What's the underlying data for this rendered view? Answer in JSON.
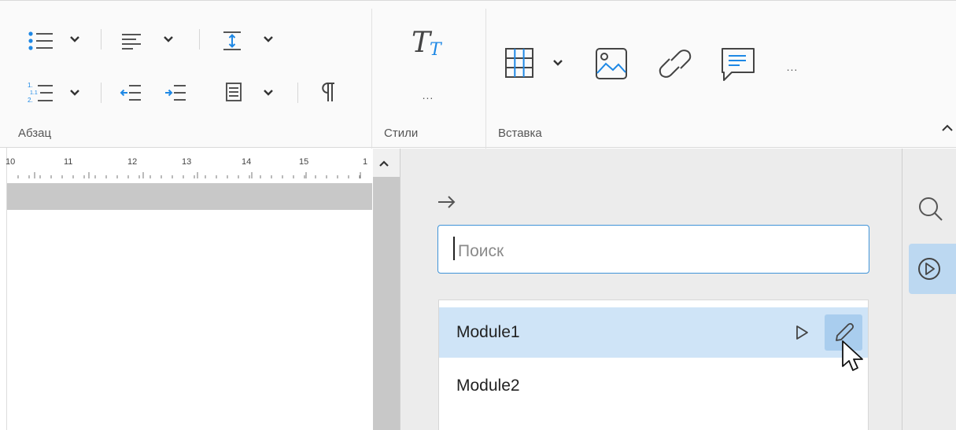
{
  "toolbar": {
    "groups": {
      "paragraph": "Абзац",
      "styles": "Стили",
      "insert": "Вставка"
    },
    "styles_more": "...",
    "insert_more": "..."
  },
  "ruler": {
    "labels": [
      "10",
      "11",
      "12",
      "13",
      "14",
      "15",
      "1"
    ]
  },
  "panel": {
    "search": {
      "placeholder": "Поиск",
      "value": ""
    },
    "modules": [
      {
        "label": "Module1",
        "selected": true
      },
      {
        "label": "Module2",
        "selected": false
      }
    ]
  },
  "colors": {
    "accent": "#3f93d8",
    "selected_row": "#cfe4f7",
    "selected_button": "#a9cdee",
    "panel_bg": "#ececec"
  },
  "icons": {
    "bulleted_list": "bulleted-list-icon",
    "numbered_list": "numbered-list-icon",
    "align": "align-left-icon",
    "line_spacing": "line-spacing-icon",
    "decrease_indent": "decrease-indent-icon",
    "increase_indent": "increase-indent-icon",
    "paragraph_spacing": "paragraph-spacing-icon",
    "pilcrow": "pilcrow-icon",
    "styles": "text-styles-icon",
    "table": "table-icon",
    "image": "image-icon",
    "link": "link-icon",
    "comment": "comment-icon",
    "collapse": "chevron-up-icon",
    "back": "arrow-right-icon",
    "run": "play-icon",
    "edit": "pencil-icon",
    "search": "search-icon",
    "macros": "play-circle-icon"
  }
}
